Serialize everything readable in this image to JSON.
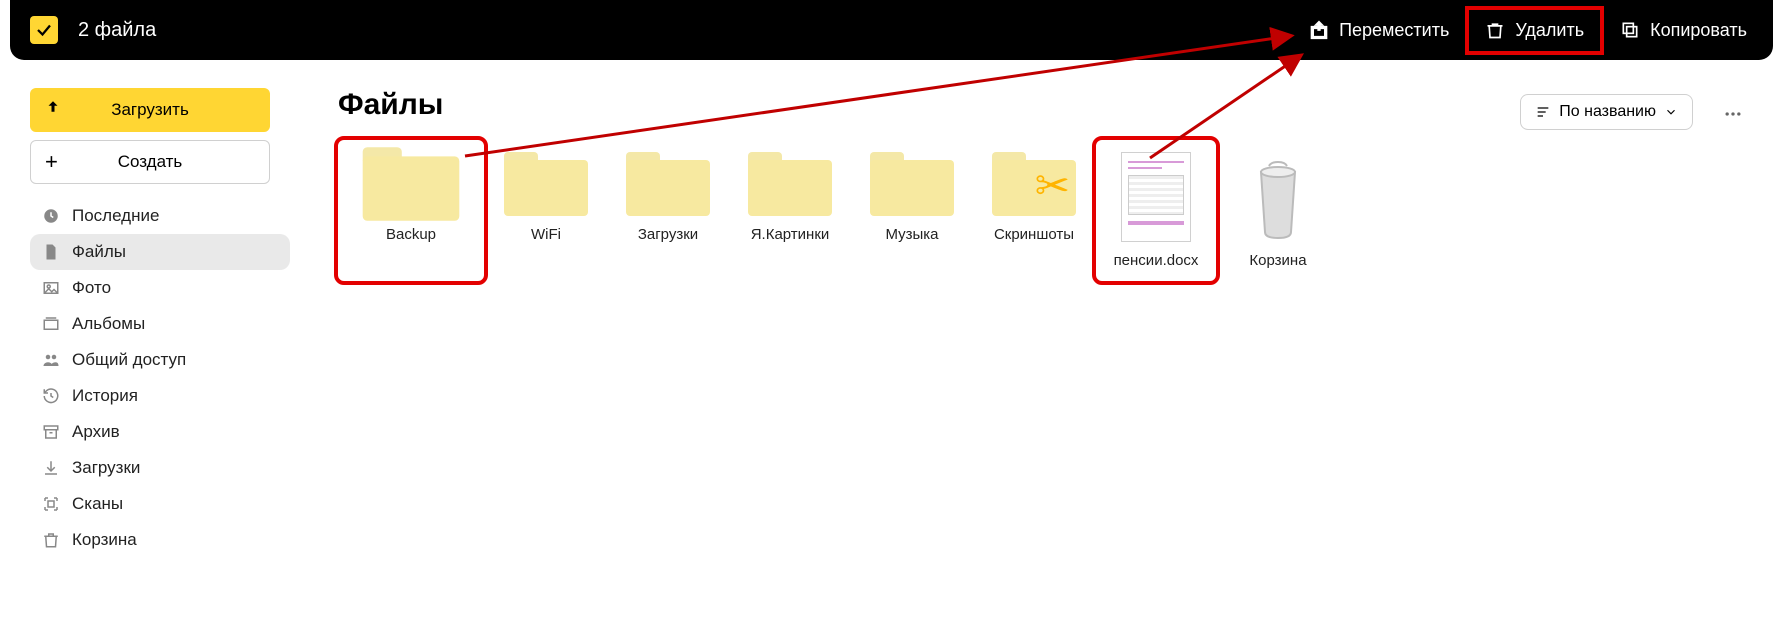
{
  "topbar": {
    "selection_label": "2 файла",
    "move_label": "Переместить",
    "delete_label": "Удалить",
    "copy_label": "Копировать"
  },
  "sidebar": {
    "upload_label": "Загрузить",
    "create_label": "Создать",
    "items": [
      {
        "label": "Последние",
        "icon": "clock"
      },
      {
        "label": "Файлы",
        "icon": "file",
        "active": true
      },
      {
        "label": "Фото",
        "icon": "image"
      },
      {
        "label": "Альбомы",
        "icon": "album"
      },
      {
        "label": "Общий доступ",
        "icon": "people"
      },
      {
        "label": "История",
        "icon": "history"
      },
      {
        "label": "Архив",
        "icon": "archive"
      },
      {
        "label": "Загрузки",
        "icon": "download"
      },
      {
        "label": "Сканы",
        "icon": "scan"
      },
      {
        "label": "Корзина",
        "icon": "trash"
      }
    ]
  },
  "content": {
    "heading": "Файлы",
    "sort_label": "По названию",
    "items": [
      {
        "label": "Backup",
        "type": "folder",
        "selected": true
      },
      {
        "label": "WiFi",
        "type": "folder"
      },
      {
        "label": "Загрузки",
        "type": "folder"
      },
      {
        "label": "Я.Картинки",
        "type": "folder"
      },
      {
        "label": "Музыка",
        "type": "folder"
      },
      {
        "label": "Скриншоты",
        "type": "folder-scissors"
      },
      {
        "label": "пенсии.docx",
        "type": "doc",
        "selected": true
      },
      {
        "label": "Корзина",
        "type": "trash"
      }
    ]
  }
}
